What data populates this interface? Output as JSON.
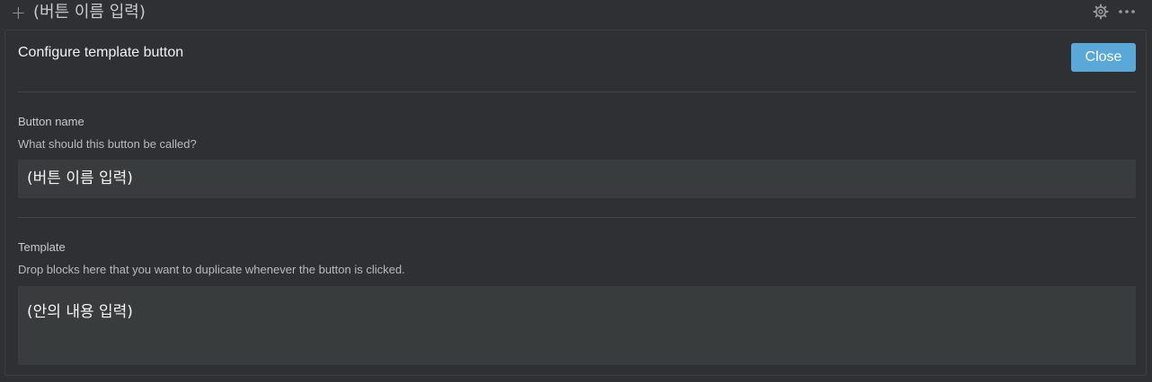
{
  "topbar": {
    "icon": "plus-icon",
    "title": "(버튼 이름 입력)",
    "right_icons": [
      "gear-icon",
      "more-icon"
    ]
  },
  "panel": {
    "title": "Configure template button",
    "close_label": "Close"
  },
  "button_name": {
    "label": "Button name",
    "hint": "What should this button be called?",
    "value": "(버튼 이름 입력)"
  },
  "template": {
    "label": "Template",
    "hint": "Drop blocks here that you want to duplicate whenever the button is clicked.",
    "content": "(안의 내용 입력)"
  },
  "colors": {
    "background": "#2f3034",
    "accent": "#59a8d8",
    "input_bg": "#383c3c"
  }
}
